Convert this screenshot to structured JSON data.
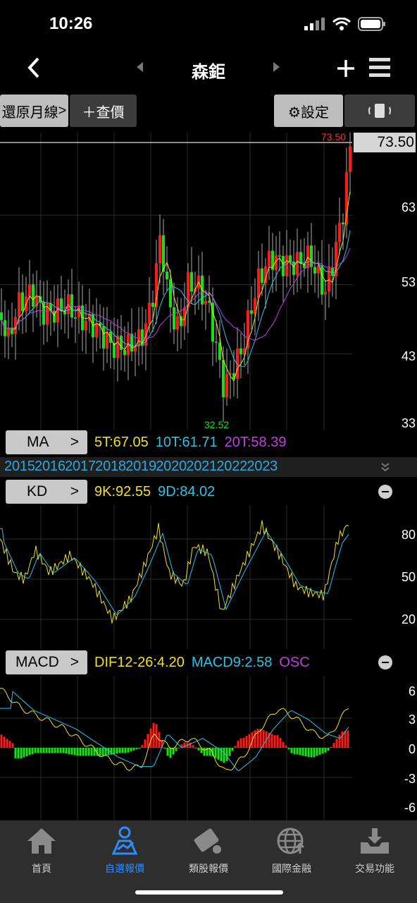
{
  "status": {
    "time": "10:26"
  },
  "nav": {
    "title": "森鉅",
    "back_icon": "chevron-left-icon",
    "prev_icon": "triangle-left-icon",
    "next_icon": "triangle-right-icon",
    "add_icon": "plus-icon",
    "menu_icon": "hamburger-icon"
  },
  "toolbar": {
    "restore_label": "還原月線",
    "restore_arrow": ">",
    "quote_label": "＋查價",
    "settings_label": "⚙設定",
    "rotate_icon": "rotate-icon"
  },
  "price_chart": {
    "high_label": "73.50",
    "last_price": "73.50",
    "low_label": "32.52",
    "axis_ticks": [
      "63",
      "53",
      "43",
      "33"
    ],
    "ylim": [
      33,
      73.5
    ]
  },
  "ma": {
    "label": "MA",
    "arrow": ">",
    "t5": "5T:67.05",
    "t10": "10T:61.71",
    "t20": "20T:58.39"
  },
  "years": {
    "text": "2015 2016 2017 2018 2019 2020 2021 2022 2023"
  },
  "kd": {
    "label": "KD",
    "arrow": ">",
    "k": "9K:92.55",
    "d": "9D:84.02",
    "axis_ticks": [
      "80",
      "50",
      "20"
    ]
  },
  "macd": {
    "label": "MACD",
    "arrow": ">",
    "dif": "DIF12-26:4.20",
    "macd9": "MACD9:2.58",
    "osc": "OSC",
    "axis_ticks": [
      "6",
      "3",
      "0",
      "-3",
      "-6"
    ]
  },
  "tabs": [
    {
      "label": "首頁",
      "icon": "home-icon",
      "active": false
    },
    {
      "label": "自選報價",
      "icon": "watchlist-icon",
      "active": true
    },
    {
      "label": "類股報價",
      "icon": "sector-icon",
      "active": false
    },
    {
      "label": "國際金融",
      "icon": "globe-icon",
      "active": false
    },
    {
      "label": "交易功能",
      "icon": "trade-icon",
      "active": false
    }
  ],
  "colors": {
    "up": "#ff1a1a",
    "down": "#18e018",
    "ma5": "#f0e020",
    "ma10": "#29c4e8",
    "ma20": "#c040e0",
    "years": "#29a9e0"
  }
}
